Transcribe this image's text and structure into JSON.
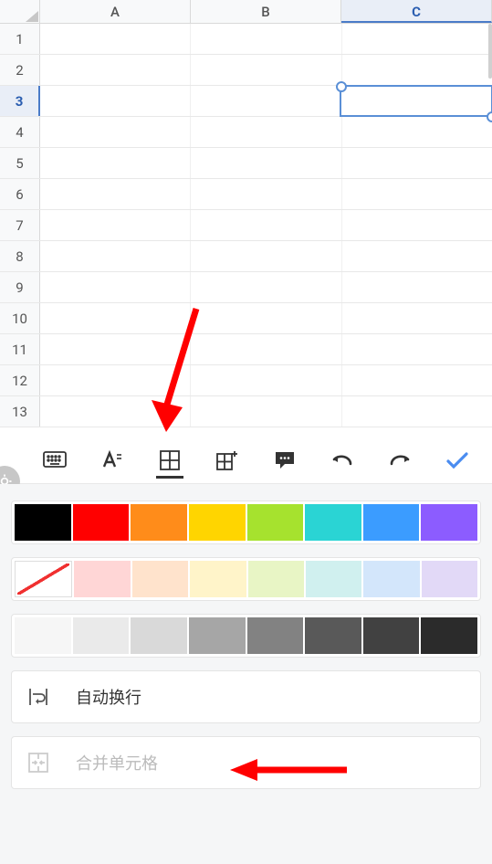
{
  "grid": {
    "columns": [
      "A",
      "B",
      "C"
    ],
    "rows": [
      1,
      2,
      3,
      4,
      5,
      6,
      7,
      8,
      9,
      10,
      11,
      12,
      13
    ],
    "selected_cell": {
      "col": "C",
      "row": 3
    }
  },
  "toolbar": {
    "items": [
      {
        "name": "keyboard-icon"
      },
      {
        "name": "text-format-icon"
      },
      {
        "name": "cell-format-icon",
        "active": true
      },
      {
        "name": "insert-icon"
      },
      {
        "name": "comment-icon"
      },
      {
        "name": "undo-icon"
      },
      {
        "name": "redo-icon"
      },
      {
        "name": "confirm-icon"
      }
    ]
  },
  "panel": {
    "swatch_rows": [
      {
        "kind": "solid",
        "colors": [
          "#000000",
          "#ff0000",
          "#ff8c1a",
          "#ffd500",
          "#a6e22e",
          "#2ad4d4",
          "#3b9cff",
          "#8c5cff"
        ]
      },
      {
        "kind": "light",
        "colors": [
          "NOFILL",
          "#ffd6d6",
          "#ffe3cc",
          "#fff4c9",
          "#e8f5c5",
          "#d0f0ef",
          "#d3e6fb",
          "#e2d9f7"
        ]
      },
      {
        "kind": "gray",
        "colors": [
          "#f6f6f6",
          "#eaeaea",
          "#d9d9d9",
          "#a6a6a6",
          "#828282",
          "#595959",
          "#414141",
          "#2b2b2b"
        ]
      }
    ],
    "wrap_label": "自动换行",
    "merge_label": "合并单元格"
  }
}
